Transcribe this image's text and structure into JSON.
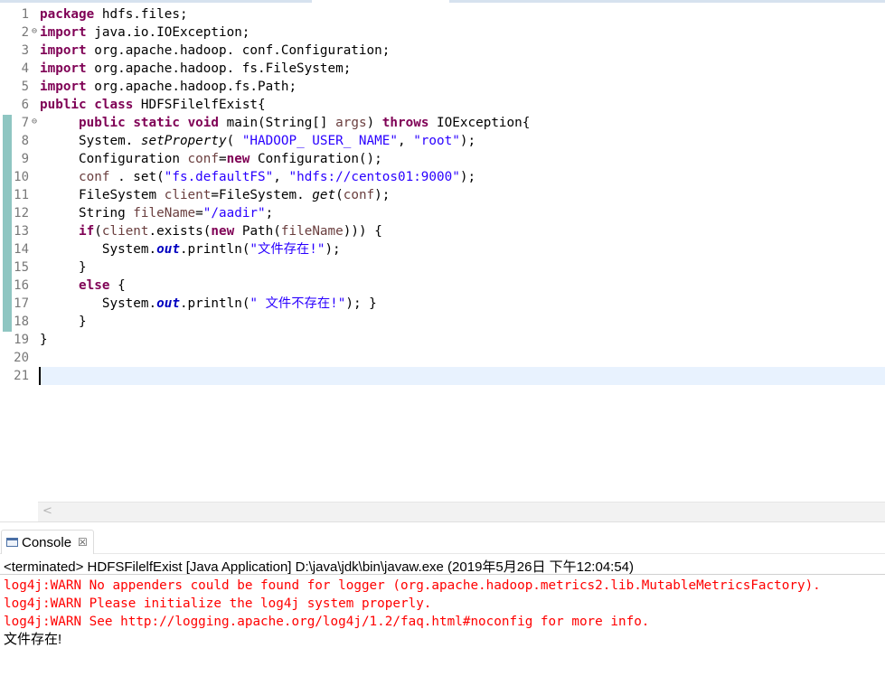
{
  "editor": {
    "line_numbers": [
      "1",
      "2",
      "3",
      "4",
      "5",
      "6",
      "7",
      "8",
      "9",
      "10",
      "11",
      "12",
      "13",
      "14",
      "15",
      "16",
      "17",
      "18",
      "19",
      "20",
      "21"
    ],
    "fold_markers": {
      "1": "⊖",
      "6": "⊖"
    },
    "lines": [
      [
        {
          "t": "package",
          "c": "kw"
        },
        {
          "t": " hdfs.files;"
        }
      ],
      [
        {
          "t": "import",
          "c": "kw"
        },
        {
          "t": " java.io.IOException;"
        }
      ],
      [
        {
          "t": "import",
          "c": "kw"
        },
        {
          "t": " org.apache.hadoop. conf.Configuration;"
        }
      ],
      [
        {
          "t": "import",
          "c": "kw"
        },
        {
          "t": " org.apache.hadoop. fs.FileSystem;"
        }
      ],
      [
        {
          "t": "import",
          "c": "kw"
        },
        {
          "t": " org.apache.hadoop.fs.Path;"
        }
      ],
      [
        {
          "t": "public",
          "c": "kw"
        },
        {
          "t": " "
        },
        {
          "t": "class",
          "c": "kw"
        },
        {
          "t": " HDFSFilelfExist{"
        }
      ],
      [
        {
          "t": "     "
        },
        {
          "t": "public",
          "c": "kw"
        },
        {
          "t": " "
        },
        {
          "t": "static",
          "c": "kw"
        },
        {
          "t": " "
        },
        {
          "t": "void",
          "c": "kw"
        },
        {
          "t": " main(String[] "
        },
        {
          "t": "args",
          "c": "var"
        },
        {
          "t": ") "
        },
        {
          "t": "throws",
          "c": "kw"
        },
        {
          "t": " IOException{"
        }
      ],
      [
        {
          "t": "     System. "
        },
        {
          "t": "setProperty",
          "c": "st"
        },
        {
          "t": "( "
        },
        {
          "t": "\"HADOOP_ USER_ NAME\"",
          "c": "str"
        },
        {
          "t": ", "
        },
        {
          "t": "\"root\"",
          "c": "str"
        },
        {
          "t": ");"
        }
      ],
      [
        {
          "t": "     Configuration "
        },
        {
          "t": "conf",
          "c": "var"
        },
        {
          "t": "="
        },
        {
          "t": "new",
          "c": "kw"
        },
        {
          "t": " Configuration();"
        }
      ],
      [
        {
          "t": "     "
        },
        {
          "t": "conf",
          "c": "var"
        },
        {
          "t": " . set("
        },
        {
          "t": "\"fs.defaultFS\"",
          "c": "str"
        },
        {
          "t": ", "
        },
        {
          "t": "\"hdfs://centos01:9000\"",
          "c": "str"
        },
        {
          "t": ");"
        }
      ],
      [
        {
          "t": "     FileSystem "
        },
        {
          "t": "client",
          "c": "var"
        },
        {
          "t": "=FileSystem. "
        },
        {
          "t": "get",
          "c": "st"
        },
        {
          "t": "("
        },
        {
          "t": "conf",
          "c": "var"
        },
        {
          "t": ");"
        }
      ],
      [
        {
          "t": "     String "
        },
        {
          "t": "fileName",
          "c": "var"
        },
        {
          "t": "="
        },
        {
          "t": "\"/aadir\"",
          "c": "str"
        },
        {
          "t": ";"
        }
      ],
      [
        {
          "t": "     "
        },
        {
          "t": "if",
          "c": "kw"
        },
        {
          "t": "("
        },
        {
          "t": "client",
          "c": "var"
        },
        {
          "t": ".exists("
        },
        {
          "t": "new",
          "c": "kw"
        },
        {
          "t": " Path("
        },
        {
          "t": "fileName",
          "c": "var"
        },
        {
          "t": "))) {"
        }
      ],
      [
        {
          "t": "        System."
        },
        {
          "t": "out",
          "c": "fld"
        },
        {
          "t": ".println("
        },
        {
          "t": "\"文件存在!\"",
          "c": "str"
        },
        {
          "t": ");"
        }
      ],
      [
        {
          "t": "     }"
        }
      ],
      [
        {
          "t": "     "
        },
        {
          "t": "else",
          "c": "kw"
        },
        {
          "t": " {"
        }
      ],
      [
        {
          "t": "        System."
        },
        {
          "t": "out",
          "c": "fld"
        },
        {
          "t": ".println("
        },
        {
          "t": "\" 文件不存在!\"",
          "c": "str"
        },
        {
          "t": "); }"
        }
      ],
      [
        {
          "t": "     }"
        }
      ],
      [
        {
          "t": "}"
        }
      ],
      [
        {
          "t": ""
        }
      ],
      [
        {
          "t": ""
        }
      ]
    ],
    "current_line": 21,
    "scroll_left_glyph": "<"
  },
  "console": {
    "tab_label": "Console",
    "tab_close": "☒",
    "terminated_text": "<terminated> HDFSFilelfExist [Java Application] D:\\java\\jdk\\bin\\javaw.exe (2019年5月26日 下午12:04:54)",
    "output_lines": [
      {
        "text": "log4j:WARN No appenders could be found for logger (org.apache.hadoop.metrics2.lib.MutableMetricsFactory).",
        "type": "err"
      },
      {
        "text": "log4j:WARN Please initialize the log4j system properly.",
        "type": "err"
      },
      {
        "text": "log4j:WARN See http://logging.apache.org/log4j/1.2/faq.html#noconfig for more info.",
        "type": "err"
      },
      {
        "text": "文件存在!",
        "type": "std"
      }
    ]
  },
  "colors": {
    "keyword": "#7f0055",
    "string": "#2a00ff",
    "variable": "#6a3e3e",
    "field": "#0000c0",
    "stderr": "#ff0000",
    "current_line": "#e8f2fe",
    "change_bar": "#8fc6c2"
  }
}
